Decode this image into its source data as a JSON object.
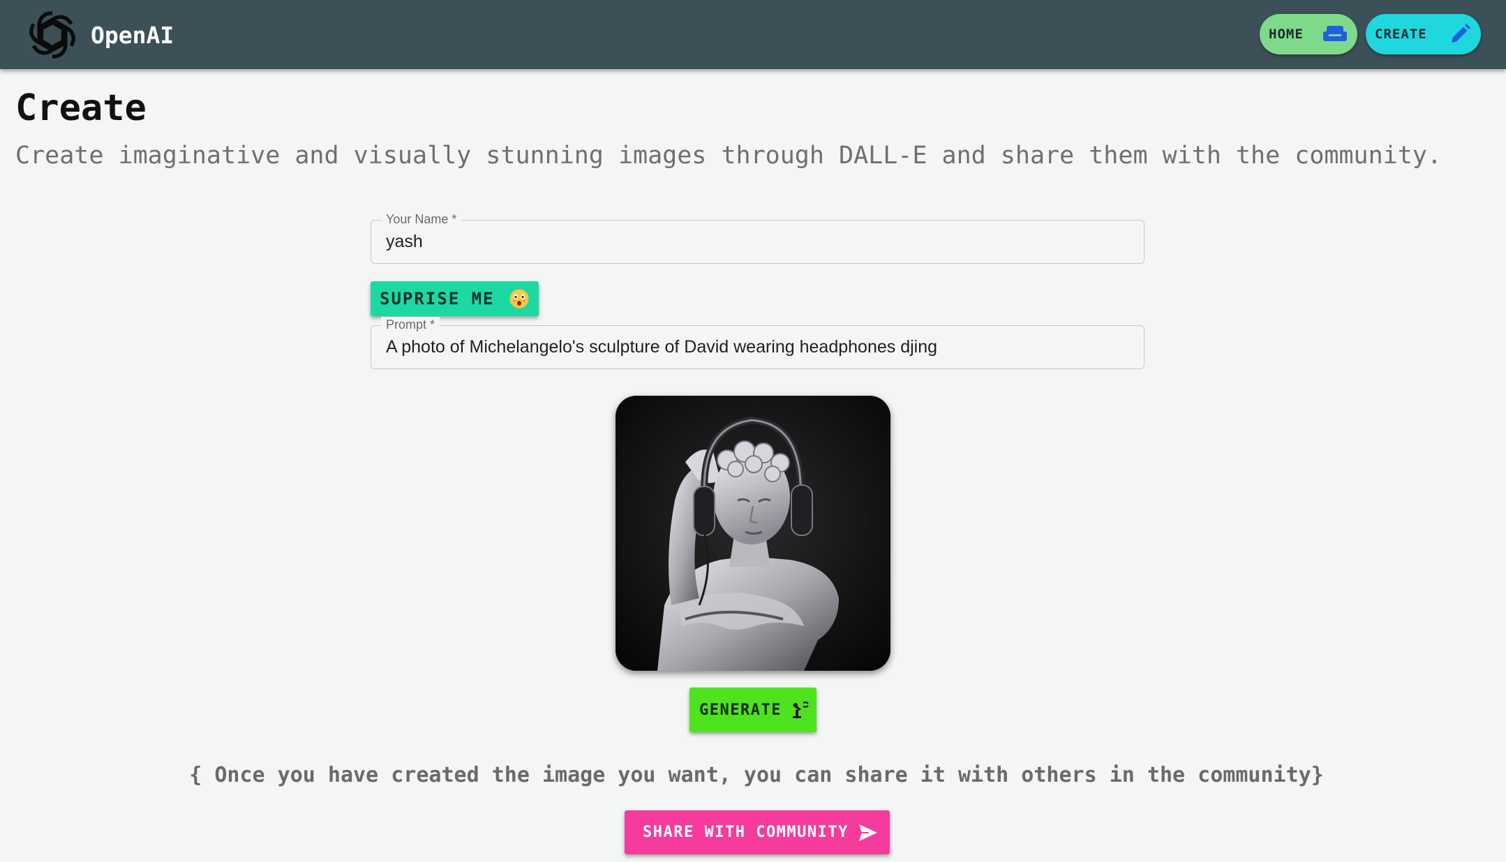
{
  "navbar": {
    "brand": "OpenAI",
    "logo_icon": "openai-logo-icon",
    "home": {
      "label": "HOME",
      "icon": "sofa-icon",
      "color": "#7fd98a"
    },
    "create": {
      "label": "CREATE",
      "icon": "pencil-icon",
      "color": "#1fd7de"
    }
  },
  "header": {
    "title": "Create",
    "subtitle": "Create imaginative and visually stunning images through DALL-E and share them with the community."
  },
  "form": {
    "name": {
      "label": "Your Name *",
      "value": "yash"
    },
    "surprise_button": {
      "label": "SUPRISE ME",
      "icon": "astonished-face-emoji",
      "color": "#1ed8a4"
    },
    "prompt": {
      "label": "Prompt *",
      "value": "A photo of Michelangelo's sculpture of David wearing headphones djing"
    }
  },
  "preview": {
    "alt": "generated-image"
  },
  "generate_button": {
    "label": "GENERATE",
    "icon": "robotic-arm-icon",
    "color": "#4fe31e"
  },
  "share": {
    "note": "{ Once you have created the image you want, you can share it with others in the community}",
    "button_label": "SHARE WITH COMMUNITY",
    "icon": "send-icon",
    "color": "#f53c9c"
  }
}
